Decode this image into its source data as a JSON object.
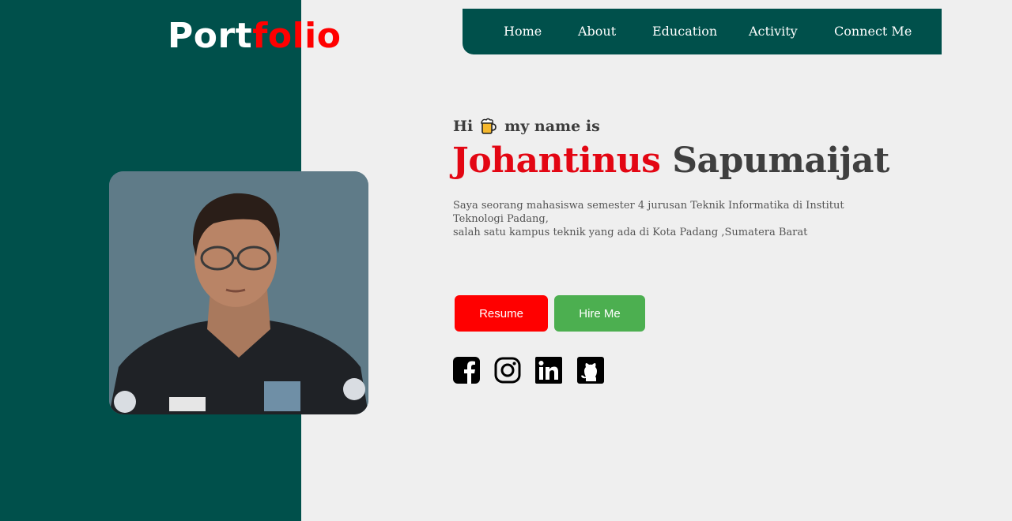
{
  "logo": {
    "part1": "Port",
    "part2": "folio"
  },
  "nav": {
    "items": [
      "Home",
      "About",
      "Education",
      "Activity",
      "Connect Me"
    ]
  },
  "hero": {
    "greeting_before": "Hi",
    "greeting_emoji": "beer-mug-icon",
    "greeting_after": "my name is",
    "first_name": "Johantinus",
    "last_name": "Sapumaijat",
    "bio_line1": "Saya seorang mahasiswa semester 4 jurusan Teknik Informatika di Institut Teknologi Padang,",
    "bio_line2": "salah satu kampus teknik yang ada di Kota Padang ,Sumatera Barat"
  },
  "buttons": {
    "resume": "Resume",
    "hire": "Hire Me"
  },
  "social": [
    "facebook-icon",
    "instagram-icon",
    "linkedin-icon",
    "github-icon"
  ],
  "colors": {
    "panel": "#00504b",
    "background": "#efefef",
    "accent_red": "#ff0000",
    "accent_green": "#4caf50"
  }
}
